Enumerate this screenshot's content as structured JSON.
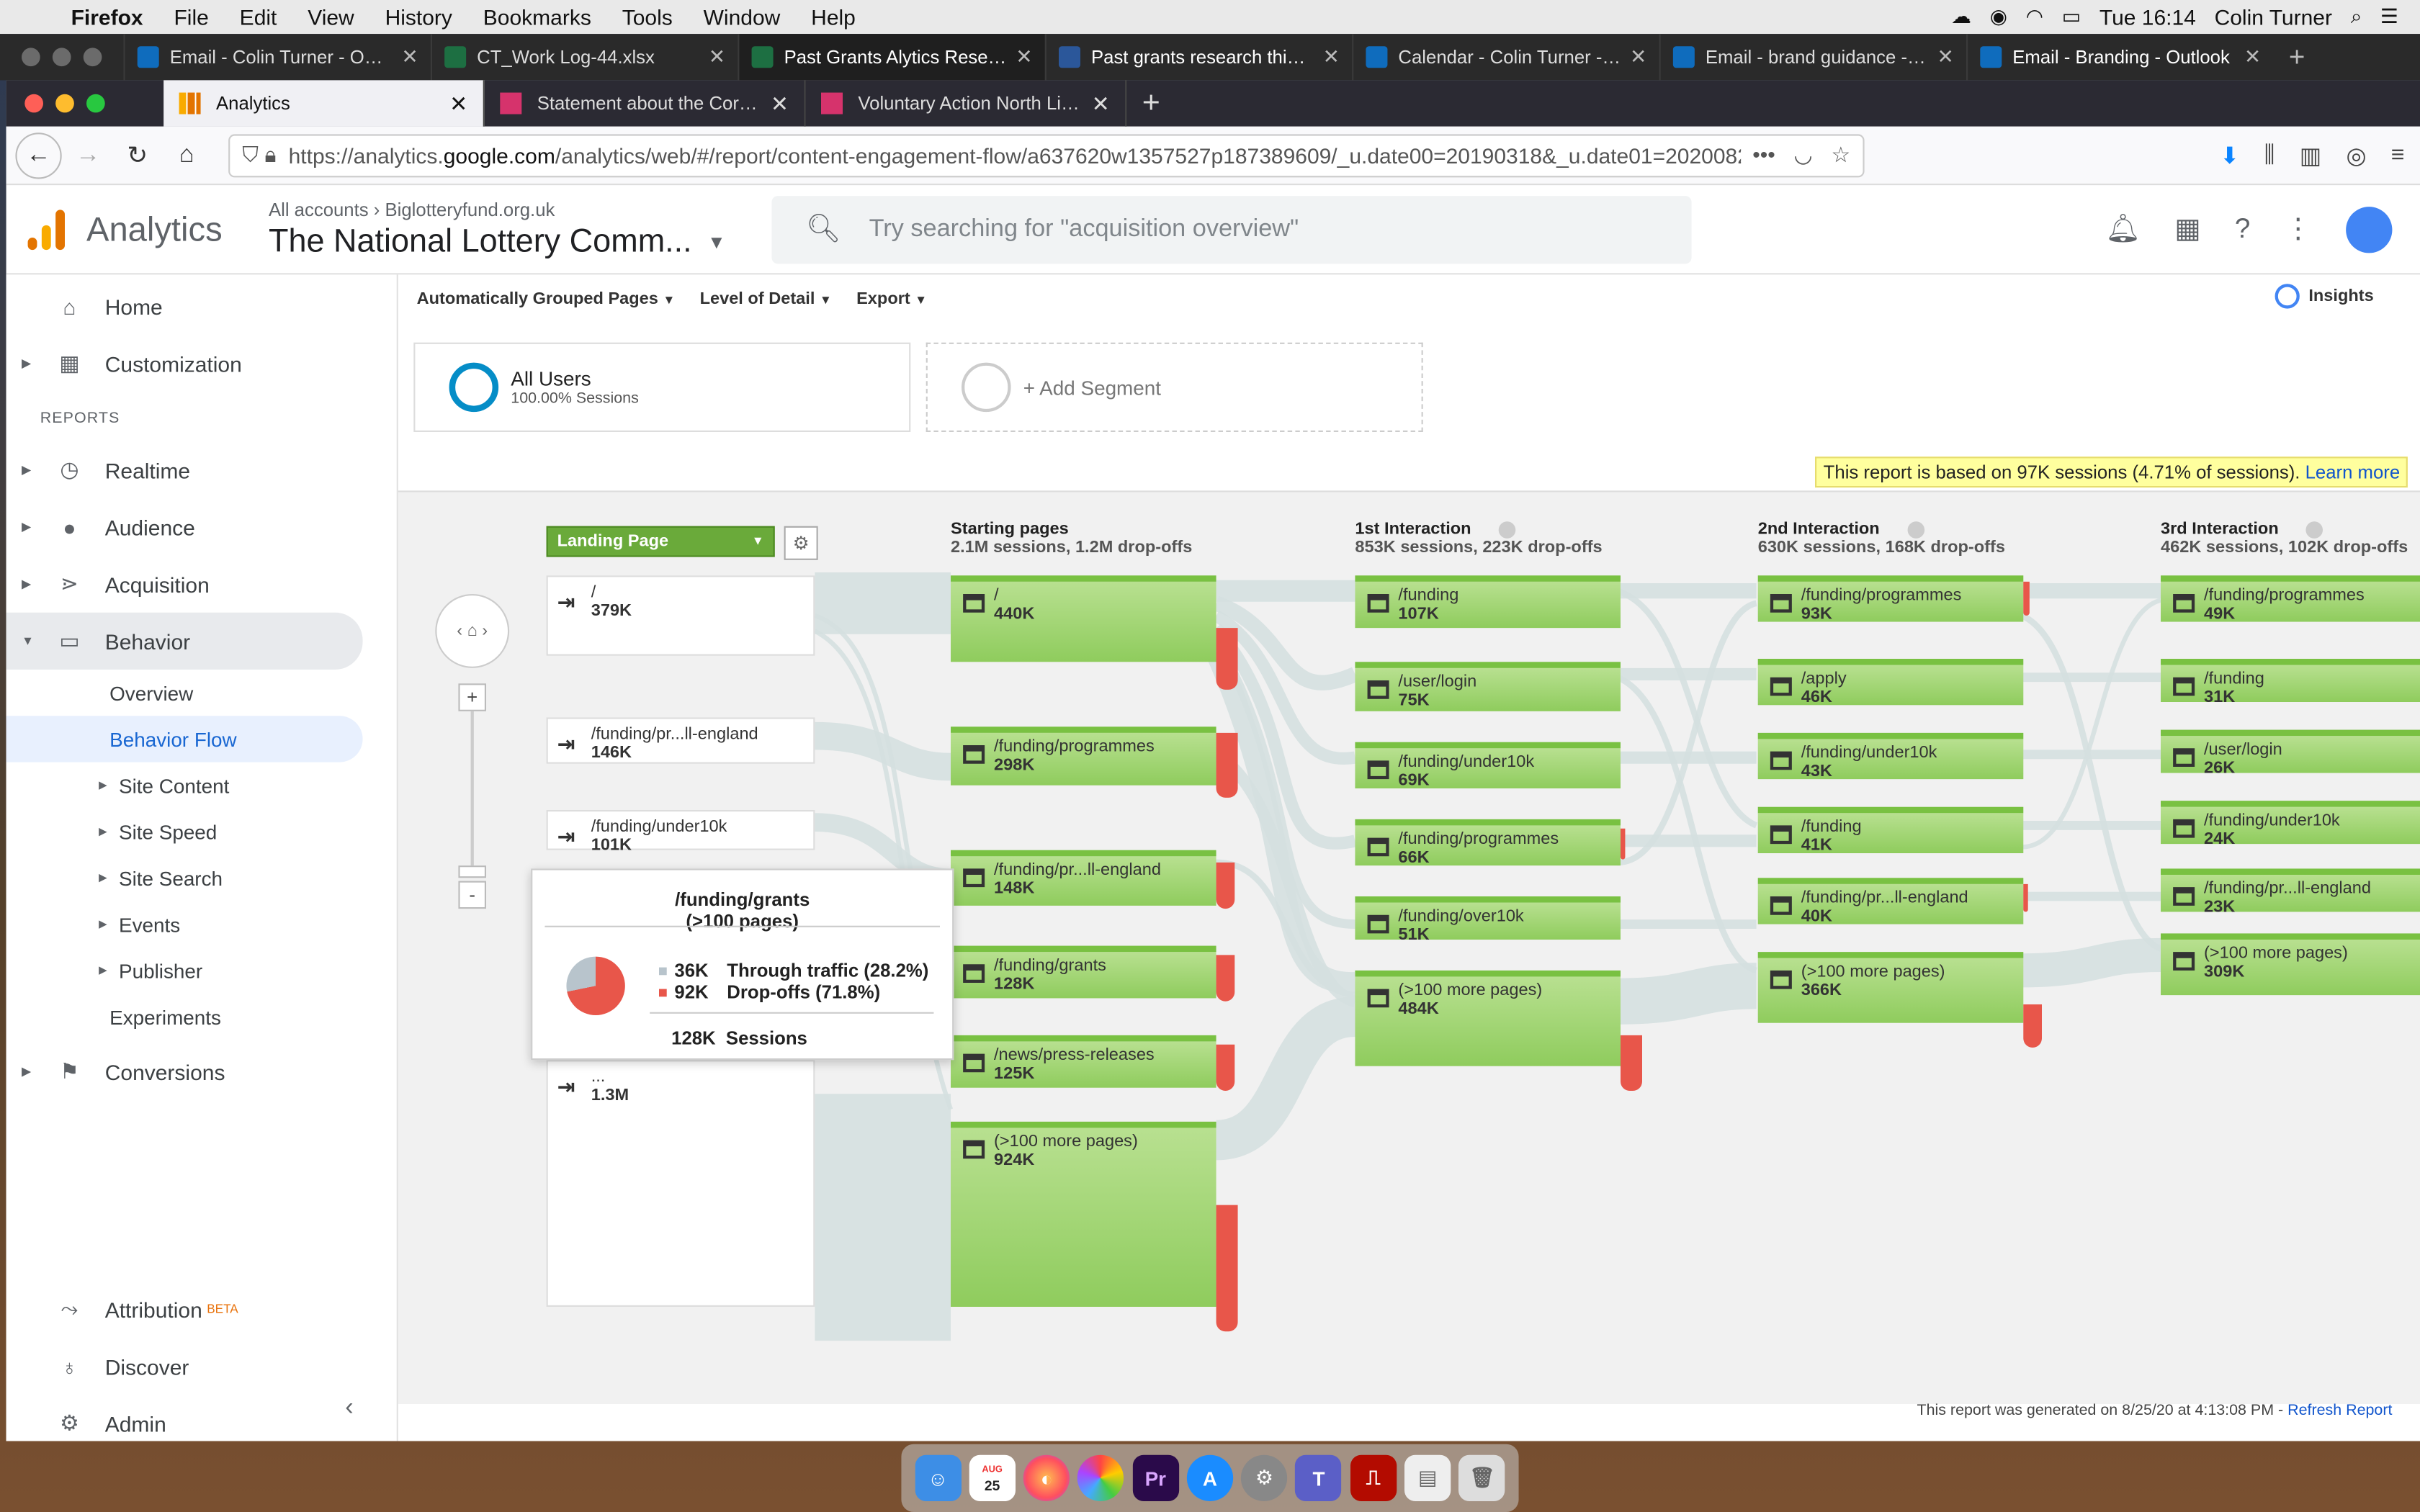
{
  "menubar": {
    "app": "Firefox",
    "items": [
      "File",
      "Edit",
      "View",
      "History",
      "Bookmarks",
      "Tools",
      "Window",
      "Help"
    ],
    "clock": "Tue 16:14",
    "user": "Colin Turner"
  },
  "outer_tabs": [
    {
      "title": "Email - Colin Turner - Outlook",
      "color": "#0f6cbd"
    },
    {
      "title": "CT_Work Log-44.xlsx",
      "color": "#1d6f42"
    },
    {
      "title": "Past Grants Alytics Research",
      "color": "#1d6f42"
    },
    {
      "title": "Past grants research thinking",
      "color": "#2b579a"
    },
    {
      "title": "Calendar - Colin Turner - Outlook",
      "color": "#0f6cbd"
    },
    {
      "title": "Email - brand guidance - Outlook",
      "color": "#0f6cbd"
    },
    {
      "title": "Email - Branding - Outlook",
      "color": "#0f6cbd"
    }
  ],
  "inner_tabs": [
    {
      "title": "Analytics",
      "active": true
    },
    {
      "title": "Statement about the Coronavirus",
      "active": false
    },
    {
      "title": "Voluntary Action North Lincolnshire",
      "active": false
    }
  ],
  "url": {
    "prefix": "https://analytics.",
    "domain": "google.com",
    "rest": "/analytics/web/#/report/content-engagement-flow/a637620w1357527p187389609/_u.date00=20190318&_u.date01=2020082"
  },
  "ga": {
    "title": "Analytics",
    "crumb_all": "All accounts",
    "crumb_site": "Biglotteryfund.org.uk",
    "property": "The National Lottery Comm...",
    "search_placeholder": "Try searching for \"acquisition overview\""
  },
  "sidebar": {
    "home": "Home",
    "customization": "Customization",
    "reports_heading": "REPORTS",
    "realtime": "Realtime",
    "audience": "Audience",
    "acquisition": "Acquisition",
    "behavior": "Behavior",
    "behavior_items": [
      "Overview",
      "Behavior Flow",
      "Site Content",
      "Site Speed",
      "Site Search",
      "Events",
      "Publisher",
      "Experiments"
    ],
    "conversions": "Conversions",
    "attribution": "Attribution",
    "beta": "BETA",
    "discover": "Discover",
    "admin": "Admin"
  },
  "toolbar": {
    "grouped": "Automatically Grouped Pages",
    "detail": "Level of Detail",
    "export": "Export",
    "insights": "Insights"
  },
  "segments": {
    "all_name": "All Users",
    "all_sub": "100.00% Sessions",
    "add": "+ Add Segment"
  },
  "notice": {
    "text": "This report is based on 97K sessions (4.71% of sessions).",
    "link": "Learn more"
  },
  "flow": {
    "landing_select": "Landing Page",
    "columns": [
      {
        "title": "Starting pages",
        "sub": "2.1M sessions, 1.2M drop-offs"
      },
      {
        "title": "1st Interaction",
        "sub": "853K sessions, 223K drop-offs"
      },
      {
        "title": "2nd Interaction",
        "sub": "630K sessions, 168K drop-offs"
      },
      {
        "title": "3rd Interaction",
        "sub": "462K sessions, 102K drop-offs"
      }
    ],
    "landing": [
      {
        "name": "/",
        "value": "379K"
      },
      {
        "name": "/funding/pr...ll-england",
        "value": "146K"
      },
      {
        "name": "/funding/under10k",
        "value": "101K"
      },
      {
        "name": "...",
        "value": "1.3M"
      }
    ],
    "starting": [
      {
        "name": "/",
        "value": "440K"
      },
      {
        "name": "/funding/programmes",
        "value": "298K"
      },
      {
        "name": "/funding/pr...ll-england",
        "value": "148K"
      },
      {
        "name": "/funding/grants",
        "value": "128K"
      },
      {
        "name": "/news/press-releases",
        "value": "125K"
      },
      {
        "name": "(>100 more pages)",
        "value": "924K"
      }
    ],
    "first": [
      {
        "name": "/funding",
        "value": "107K"
      },
      {
        "name": "/user/login",
        "value": "75K"
      },
      {
        "name": "/funding/under10k",
        "value": "69K"
      },
      {
        "name": "/funding/programmes",
        "value": "66K"
      },
      {
        "name": "/funding/over10k",
        "value": "51K"
      },
      {
        "name": "(>100 more pages)",
        "value": "484K"
      }
    ],
    "second": [
      {
        "name": "/funding/programmes",
        "value": "93K"
      },
      {
        "name": "/apply",
        "value": "46K"
      },
      {
        "name": "/funding/under10k",
        "value": "43K"
      },
      {
        "name": "/funding",
        "value": "41K"
      },
      {
        "name": "/funding/pr...ll-england",
        "value": "40K"
      },
      {
        "name": "(>100 more pages)",
        "value": "366K"
      }
    ],
    "third": [
      {
        "name": "/funding/programmes",
        "value": "49K"
      },
      {
        "name": "/funding",
        "value": "31K"
      },
      {
        "name": "/user/login",
        "value": "26K"
      },
      {
        "name": "/funding/under10k",
        "value": "24K"
      },
      {
        "name": "/funding/pr...ll-england",
        "value": "23K"
      },
      {
        "name": "(>100 more pages)",
        "value": "309K"
      }
    ],
    "tooltip": {
      "title": "/funding/grants",
      "subtitle": "(>100 pages)",
      "through_value": "36K",
      "through_label": "Through traffic (28.2%)",
      "drop_value": "92K",
      "drop_label": "Drop-offs (71.8%)",
      "sessions_value": "128K",
      "sessions_label": "Sessions",
      "drop_fraction": 0.718
    }
  },
  "footer": {
    "text": "This report was generated on 8/25/20 at 4:13:08 PM -",
    "link": "Refresh Report"
  },
  "colors": {
    "node_green": "#8fcc5d",
    "dropoff_red": "#e8564a",
    "ga_blue": "#1967d2"
  },
  "dock": {
    "calendar_month": "AUG",
    "calendar_day": "25"
  }
}
